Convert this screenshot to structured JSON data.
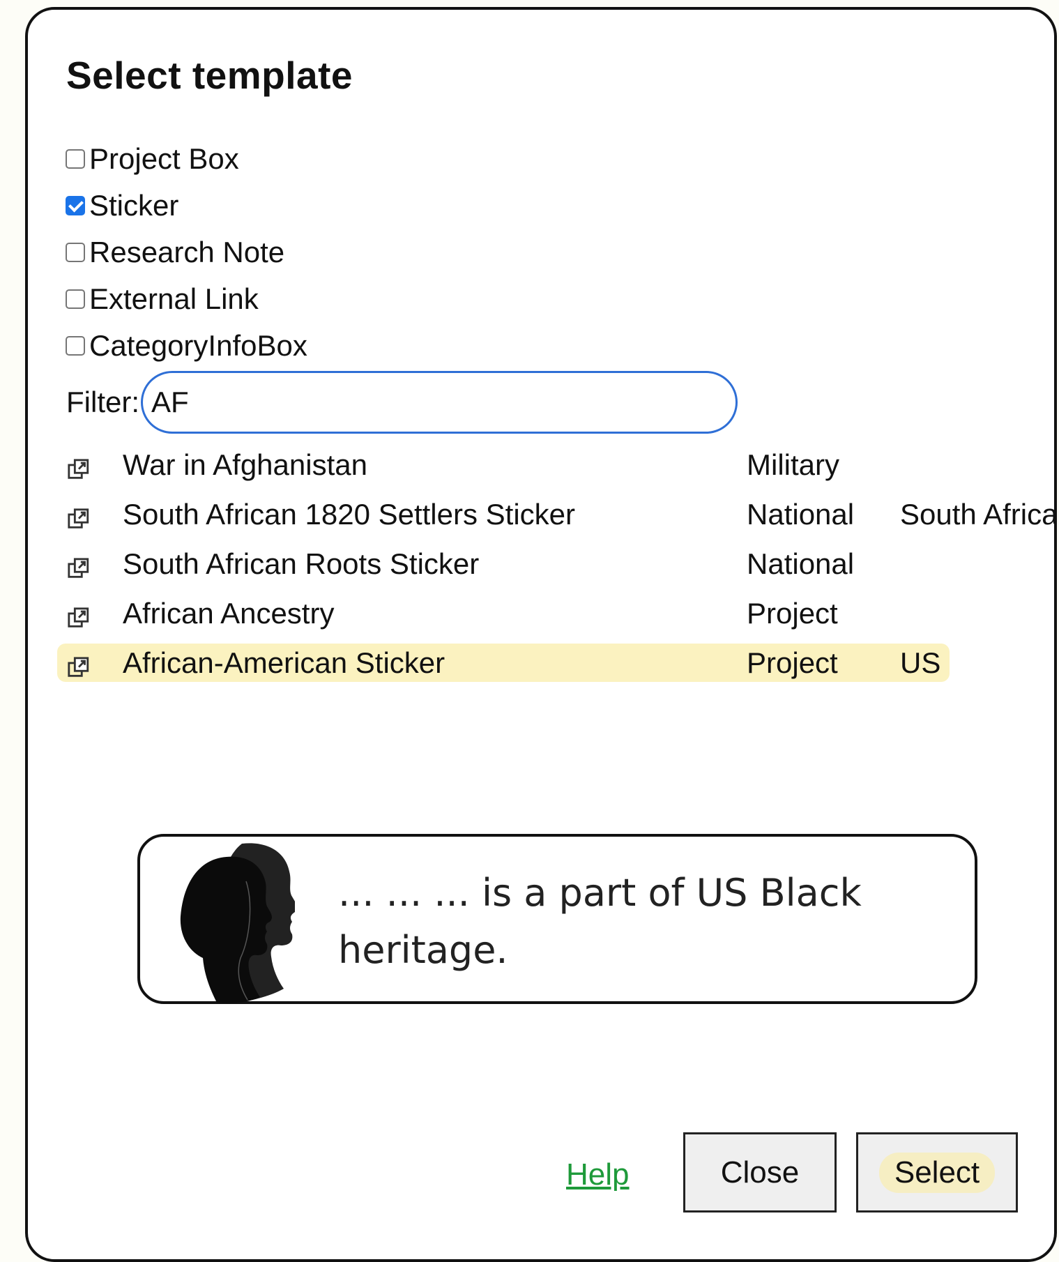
{
  "dialog": {
    "title": "Select template"
  },
  "filters": [
    {
      "label": "Project Box",
      "checked": false
    },
    {
      "label": "Sticker",
      "checked": true
    },
    {
      "label": "Research Note",
      "checked": false
    },
    {
      "label": "External Link",
      "checked": false
    },
    {
      "label": "CategoryInfoBox",
      "checked": false
    }
  ],
  "filter": {
    "label": "Filter:",
    "value": "AF"
  },
  "results": [
    {
      "name": "War in Afghanistan",
      "type": "Military",
      "region": "",
      "selected": false,
      "icon": "external-link-icon"
    },
    {
      "name": "South African 1820 Settlers Sticker",
      "type": "National",
      "region": "South Africa",
      "selected": false,
      "icon": "external-link-icon"
    },
    {
      "name": "South African Roots Sticker",
      "type": "National",
      "region": "",
      "selected": false,
      "icon": "external-link-icon"
    },
    {
      "name": "African Ancestry",
      "type": "Project",
      "region": "",
      "selected": false,
      "icon": "external-link-icon"
    },
    {
      "name": "African-American Sticker",
      "type": "Project",
      "region": "US",
      "selected": true,
      "icon": "external-link-icon"
    }
  ],
  "preview": {
    "image": "silhouette-profiles",
    "text": "... ... ... is a part of US Black heritage."
  },
  "footer": {
    "help_label": "Help",
    "close_label": "Close",
    "select_label": "Select"
  },
  "colors": {
    "accent": "#1a73e8",
    "filter_border": "#2f6fd6",
    "selected_row": "#fbf2c0",
    "help_link": "#1e9a3a",
    "select_highlight": "#f6eec3"
  }
}
